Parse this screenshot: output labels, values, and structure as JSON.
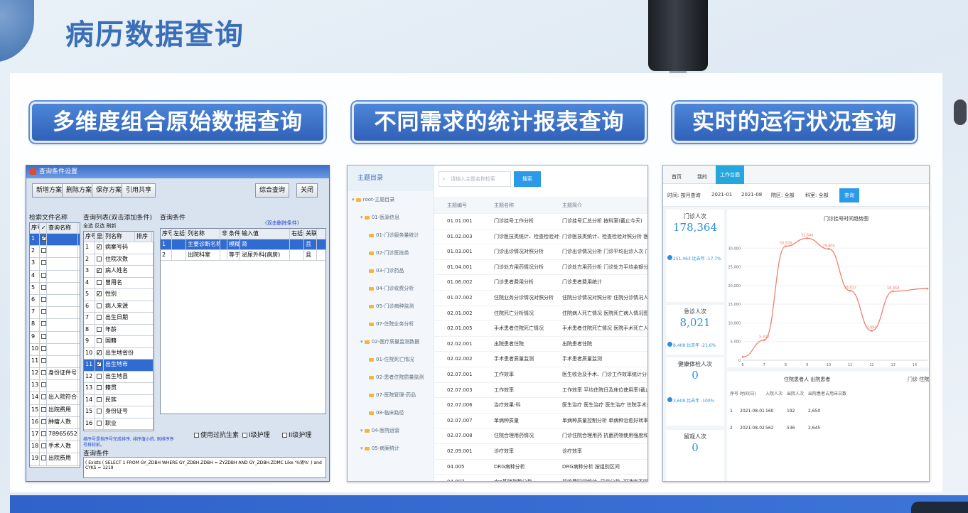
{
  "page": {
    "title": "病历数据查询",
    "sections": [
      {
        "title": "多维度组合原始数据查询"
      },
      {
        "title": "不同需求的统计报表查询"
      },
      {
        "title": "实时的运行状况查询"
      }
    ]
  },
  "colors": {
    "title": "#3a6fb8",
    "section_bg": "#2f61b8",
    "bottom_bar": "#2f63c9",
    "accent_blue": "#2a8fdb",
    "line_red": "#f08070"
  },
  "shot1": {
    "window_title": "查询条件设置",
    "buttons": [
      "新增方案",
      "删除方案",
      "保存方案",
      "引用共享",
      "综合查询",
      "关闭"
    ],
    "file_list": {
      "label": "检索文件名称",
      "headers": [
        "序号",
        "✓",
        "查询名称"
      ],
      "rows": [
        {
          "no": "1",
          "checked": true,
          "name": ""
        },
        {
          "no": "2",
          "checked": false,
          "name": ""
        },
        {
          "no": "3",
          "checked": false,
          "name": ""
        },
        {
          "no": "4",
          "checked": false,
          "name": ""
        },
        {
          "no": "5",
          "checked": false,
          "name": ""
        },
        {
          "no": "6",
          "checked": false,
          "name": ""
        },
        {
          "no": "7",
          "checked": false,
          "name": ""
        },
        {
          "no": "8",
          "checked": false,
          "name": ""
        },
        {
          "no": "9",
          "checked": false,
          "name": ""
        },
        {
          "no": "10",
          "checked": false,
          "name": ""
        },
        {
          "no": "11",
          "checked": false,
          "name": ""
        },
        {
          "no": "12",
          "checked": false,
          "name": "身份证件号"
        },
        {
          "no": "13",
          "checked": false,
          "name": ""
        },
        {
          "no": "14",
          "checked": false,
          "name": "出入院符合"
        },
        {
          "no": "15",
          "checked": false,
          "name": "出院费用"
        },
        {
          "no": "16",
          "checked": false,
          "name": "肿瘤人数"
        },
        {
          "no": "17",
          "checked": false,
          "name": "789656524"
        },
        {
          "no": "18",
          "checked": false,
          "name": "手术人数"
        },
        {
          "no": "19",
          "checked": false,
          "name": "出院费用"
        }
      ]
    },
    "field_list": {
      "label": "查询列表(双击添加条件)",
      "tabs": [
        "全选",
        "反选",
        "刷新"
      ],
      "headers": [
        "序号",
        "显示",
        "列名称",
        "排序"
      ],
      "rows": [
        {
          "no": "1",
          "checked": true,
          "name": "病案号码"
        },
        {
          "no": "2",
          "checked": false,
          "name": "住院次数"
        },
        {
          "no": "3",
          "checked": true,
          "name": "病人姓名"
        },
        {
          "no": "4",
          "checked": false,
          "name": "曾用名"
        },
        {
          "no": "5",
          "checked": true,
          "name": "性别"
        },
        {
          "no": "6",
          "checked": false,
          "name": "病人来源"
        },
        {
          "no": "7",
          "checked": false,
          "name": "出生日期"
        },
        {
          "no": "8",
          "checked": false,
          "name": "年龄"
        },
        {
          "no": "9",
          "checked": false,
          "name": "国籍"
        },
        {
          "no": "10",
          "checked": true,
          "name": "出生地省份"
        },
        {
          "no": "11",
          "checked": true,
          "name": "出生地市"
        },
        {
          "no": "12",
          "checked": false,
          "name": "出生地县"
        },
        {
          "no": "13",
          "checked": false,
          "name": "籍贯"
        },
        {
          "no": "14",
          "checked": false,
          "name": "民族"
        },
        {
          "no": "15",
          "checked": false,
          "name": "身份证号"
        },
        {
          "no": "16",
          "checked": false,
          "name": "职业"
        }
      ],
      "selected_index": 10,
      "hint": "排序号是指序号完成排序, 排序值小的, 则排序序号排较前。"
    },
    "conditions": {
      "label": "查询条件",
      "right_label": "(双击删除条件)",
      "headers": [
        "序号",
        "左括号",
        "列名称",
        "非",
        "条件",
        "输入值",
        "右括号",
        "关联"
      ],
      "rows": [
        {
          "no": "1",
          "col": "主要诊断名称",
          "cond": "模糊",
          "val": "肾",
          "rel": "且"
        },
        {
          "no": "2",
          "col": "出院科室",
          "cond": "等于",
          "val": "泌尿外科(病房)",
          "rel": "且"
        }
      ]
    },
    "checkboxes": [
      "使用过抗生素",
      "I级护理",
      "II级护理"
    ],
    "sql_label": "查询条件",
    "sql": "(  Exists ( SELECT 1 FROM GY_ZDBH WHERE GY_ZDBH.ZDBH = ZYZDBH AND GY_ZDBH.ZDMC Like '%肾%' )  and  CYKS = 1219"
  },
  "shot2": {
    "sidebar_title": "主题目录",
    "tree": [
      {
        "label": "root-主题目录",
        "level": 0
      },
      {
        "label": "01-医源信息",
        "level": 1
      },
      {
        "label": "01-门诊服务量统计",
        "level": 2
      },
      {
        "label": "02-门诊医技类",
        "level": 2
      },
      {
        "label": "03-门诊药品",
        "level": 2
      },
      {
        "label": "04-门诊收费分析",
        "level": 2
      },
      {
        "label": "05-门诊病种监测",
        "level": 2
      },
      {
        "label": "07-住院业务分析",
        "level": 2
      },
      {
        "label": "02-医疗质量监测数据",
        "level": 1
      },
      {
        "label": "01-住院死亡情况",
        "level": 2
      },
      {
        "label": "02-患者住院质量监测",
        "level": 2
      },
      {
        "label": "07-医院管理-药品",
        "level": 2
      },
      {
        "label": "08-临床路径",
        "level": 2
      },
      {
        "label": "04-医院运营",
        "level": 1
      },
      {
        "label": "05-病案统计",
        "level": 1
      }
    ],
    "search_placeholder": "请输入主题名称检索",
    "search_button": "搜索",
    "headers": [
      "主题编号",
      "主题名称",
      "主题简介"
    ],
    "rows": [
      {
        "code": "01.01.001",
        "name": "门诊挂号工作分析",
        "desc": "门诊挂号汇总分析 按科室(截止今天)"
      },
      {
        "code": "01.02.003",
        "name": "门诊医技类统计、检查检验对照分析",
        "desc": "门诊医技类统计、检查检验对照分析 医技类检查检验"
      },
      {
        "code": "01.03.001",
        "name": "门诊出诊情况对照分析",
        "desc": "门诊出诊情况分析 门诊平均出诊人次 门诊出诊平"
      },
      {
        "code": "01.04.001",
        "name": "门诊处方用药情况分析",
        "desc": "门诊处方用药分析 门诊处方平均金额分析"
      },
      {
        "code": "01.06.002",
        "name": "门诊患者费用分析",
        "desc": "门诊患者费用统计"
      },
      {
        "code": "01.07.002",
        "name": "住院业务分诊情况对照分析",
        "desc": "住院分诊情况对照分析 住院分诊情况人次分析"
      },
      {
        "code": "02.01.002",
        "name": "住院死亡分析情况",
        "desc": "住院病人死亡情况 医院死亡病人情况图"
      },
      {
        "code": "02.01.005",
        "name": "手术患者住院死亡情况",
        "desc": "手术患者住院死亡情况 医院手术死亡人数 医院"
      },
      {
        "code": "02.02.001",
        "name": "出院患者住院",
        "desc": "出院患者住院"
      },
      {
        "code": "02.02.002",
        "name": "手术患者质量监测",
        "desc": "手术患者质量监测"
      },
      {
        "code": "02.07.001",
        "name": "工作效率",
        "desc": "医生收治及手术、门诊工作效率统计分析"
      },
      {
        "code": "02.07.003",
        "name": "工作效率",
        "desc": "工作效率 平均住院日及床位使用率(截止)"
      },
      {
        "code": "02.07.006",
        "name": "治疗效果-科",
        "desc": "医生治疗 医生治疗 医生治疗 住院手术患者死亡"
      },
      {
        "code": "02.07.007",
        "name": "单病种质量",
        "desc": "单病种质量控制分析 单病种治愈好转率指标分析"
      },
      {
        "code": "02.07.008",
        "name": "住院合理用药情况",
        "desc": "门诊住院合理用药 抗菌药物使用强度和使用率"
      },
      {
        "code": "02.09.001",
        "name": "诊疗效率",
        "desc": "诊疗效率"
      },
      {
        "code": "04.005",
        "name": "DRG病种分析",
        "desc": "DRG病种分析 按组别区间"
      },
      {
        "code": "04.007",
        "name": "drg基础指数分析",
        "desc": "按收费时间统计, 显示分析, 可选定不同的"
      }
    ],
    "tooltip": "手术患者质量监测"
  },
  "shot3": {
    "tabs": [
      "首页",
      "我的",
      "工作台面"
    ],
    "active_tab": 2,
    "filter": {
      "date_label": "时间: 按月查询",
      "from": "2021-01",
      "to": "2021-08",
      "area_label": "院区: 全部",
      "dept_label": "科室: 全部",
      "button": "查询"
    },
    "kpis": [
      {
        "title": "门诊人次",
        "value": "178,364",
        "sub": "251,463 比去年 -17.7%"
      },
      {
        "title": "急诊人次",
        "value": "8,021",
        "sub": "8,408 比去年 -21.6%"
      },
      {
        "title": "健康体检人次",
        "value": "0",
        "sub": "3,608 比去年 -100%"
      },
      {
        "title": "留观人次",
        "value": "0",
        "sub": ""
      }
    ],
    "table": {
      "title": "住院患者人 出院患者",
      "headers": [
        "序号",
        "时间(日)",
        "入院人次",
        "出院人次",
        "出院患者占用床日数"
      ],
      "rows": [
        {
          "no": "1",
          "date": "2021-08-01",
          "in": "160",
          "out": "192",
          "days": "2,650"
        },
        {
          "no": "2",
          "date": "2021-08-02",
          "in": "562",
          "out": "536",
          "days": "2,645"
        }
      ],
      "side_label": "门诊 住院"
    }
  },
  "chart_data": {
    "type": "line",
    "title": "门诊挂号时间趋势图",
    "x": [
      6,
      7,
      8,
      9,
      10,
      11,
      12,
      13,
      14
    ],
    "xlim": [
      6,
      14.6
    ],
    "ylim": [
      0,
      35000
    ],
    "yticks": [
      0,
      5000,
      10000,
      15000,
      20000,
      25000,
      30000
    ],
    "series": [
      {
        "name": "",
        "points": [
          {
            "x": 6,
            "y": 900,
            "label": ""
          },
          {
            "x": 7,
            "y": 5400,
            "label": "5,400"
          },
          {
            "x": 8,
            "y": 30528,
            "label": "30,528"
          },
          {
            "x": 9,
            "y": 32644,
            "label": "32,644"
          },
          {
            "x": 10,
            "y": 29800,
            "label": "29,800"
          },
          {
            "x": 11,
            "y": 18612,
            "label": "18,612"
          },
          {
            "x": 12,
            "y": 7890,
            "label": "7,890"
          },
          {
            "x": 13,
            "y": 18458,
            "label": "18,458"
          },
          {
            "x": 14.6,
            "y": 19200,
            "label": ""
          }
        ],
        "color": "#f08070"
      }
    ]
  }
}
